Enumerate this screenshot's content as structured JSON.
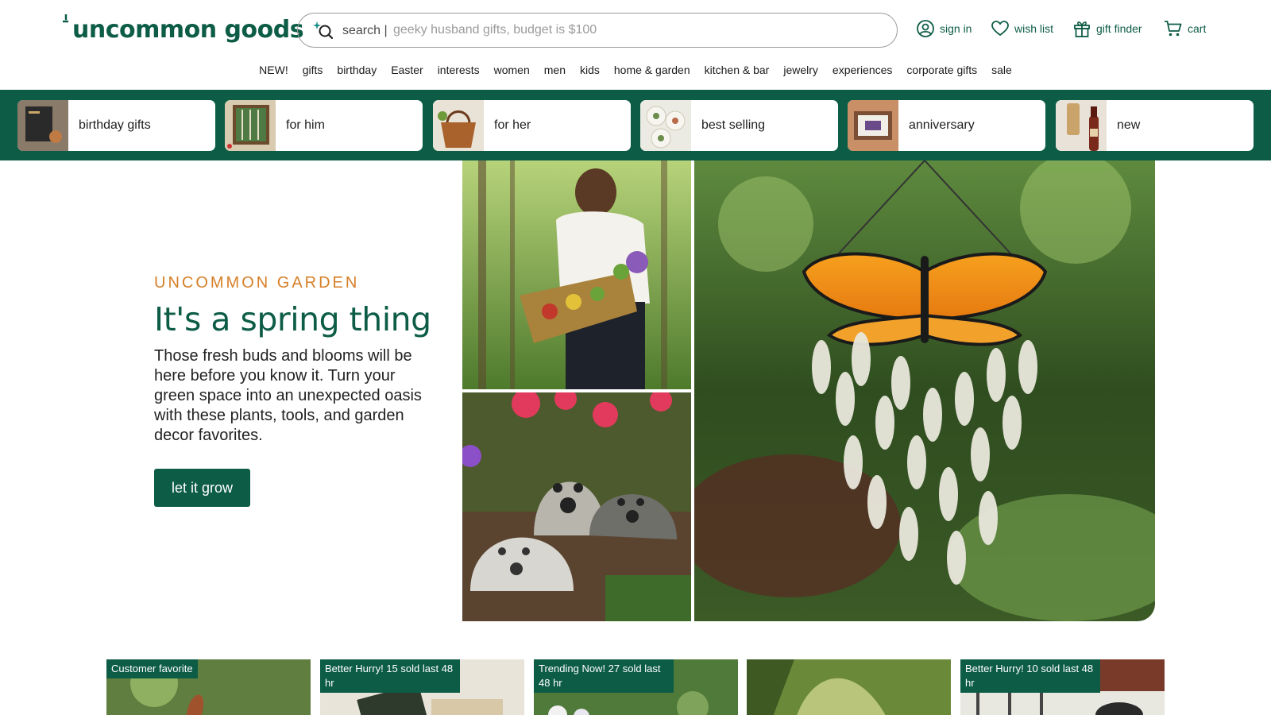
{
  "brand": {
    "name": "uncommon goods"
  },
  "search": {
    "label": "search |",
    "placeholder": "geeky husband gifts, budget is $100"
  },
  "utility": [
    {
      "label": "sign in",
      "icon": "user-circle-icon"
    },
    {
      "label": "wish list",
      "icon": "heart-icon"
    },
    {
      "label": "gift finder",
      "icon": "gift-icon"
    },
    {
      "label": "cart",
      "icon": "cart-icon"
    }
  ],
  "nav": [
    "NEW!",
    "gifts",
    "birthday",
    "Easter",
    "interests",
    "women",
    "men",
    "kids",
    "home & garden",
    "kitchen & bar",
    "jewelry",
    "experiences",
    "corporate gifts",
    "sale"
  ],
  "categories": [
    "birthday gifts",
    "for him",
    "for her",
    "best selling",
    "anniversary",
    "new"
  ],
  "hero": {
    "eyebrow": "UNCOMMON GARDEN",
    "title": "It's a spring thing",
    "body": "Those fresh buds and blooms will be here before you know it. Turn your green space into an unexpected oasis with these plants, tools, and garden decor favorites.",
    "cta": "let it grow"
  },
  "products": [
    {
      "badge": "Customer favorite"
    },
    {
      "badge": "Better Hurry! 15 sold last 48 hr"
    },
    {
      "badge": "Trending Now! 27 sold last 48 hr"
    },
    {
      "badge": ""
    },
    {
      "badge": "Better Hurry! 10 sold last 48 hr"
    }
  ],
  "colors": {
    "brand": "#0d5c46",
    "accent": "#d67f28"
  }
}
